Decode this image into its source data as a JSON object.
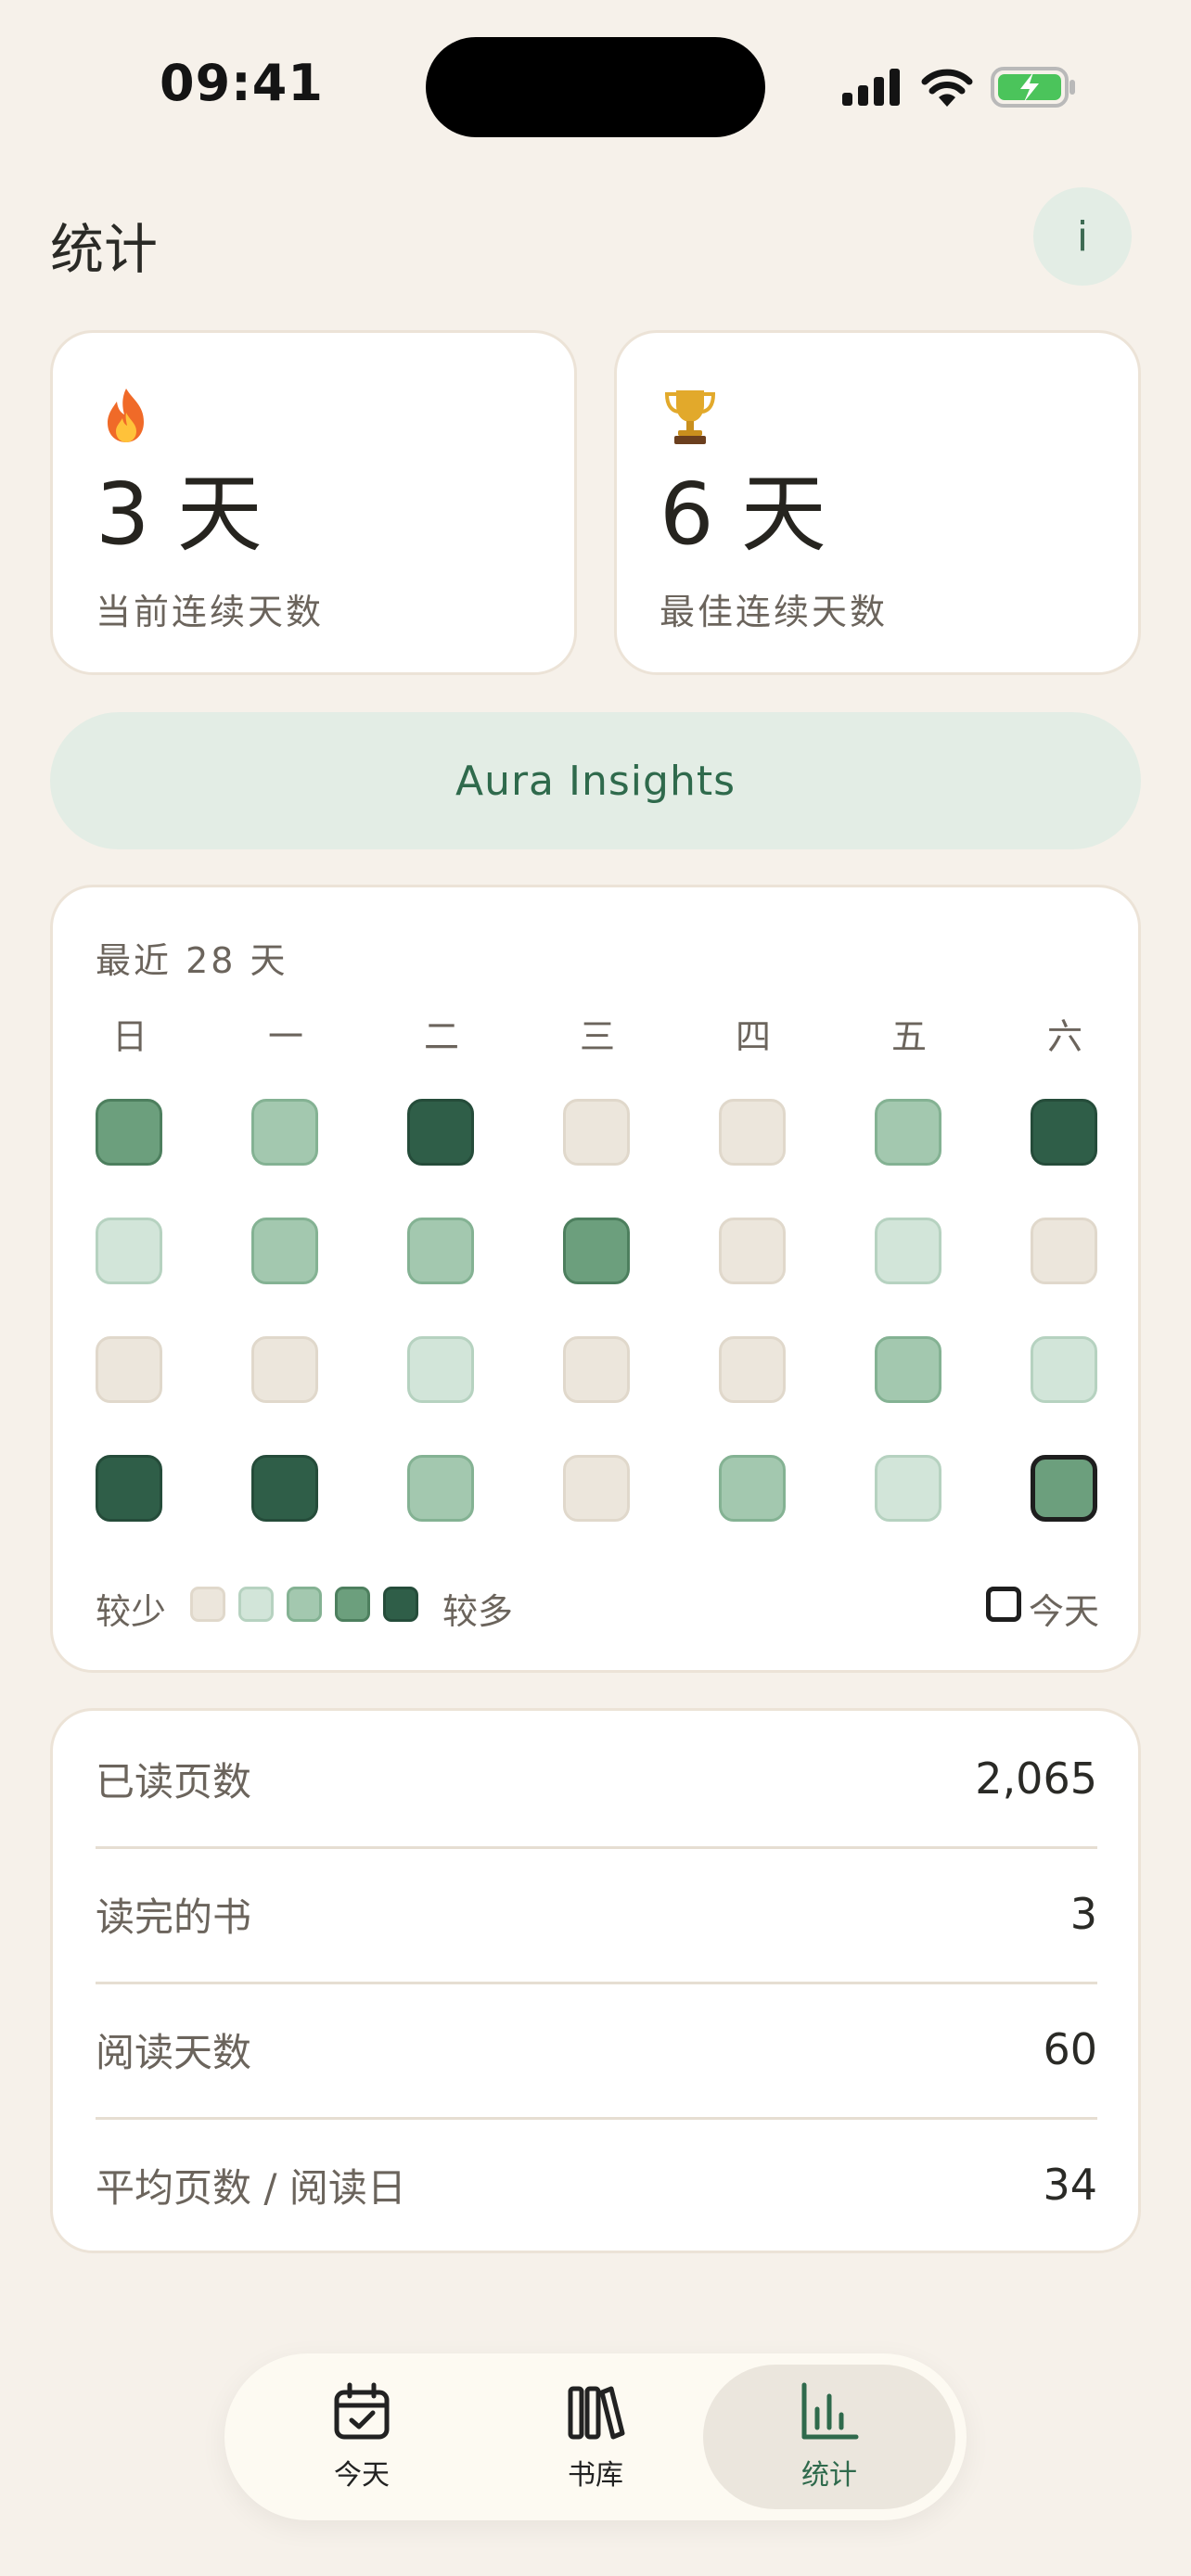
{
  "status_bar": {
    "time": "09:41"
  },
  "header": {
    "title": "统计",
    "info_label": "i"
  },
  "streaks": [
    {
      "icon": "fire-icon",
      "value": "3 天",
      "label": "当前连续天数"
    },
    {
      "icon": "trophy-icon",
      "value": "6 天",
      "label": "最佳连续天数"
    }
  ],
  "insights_button": "Aura Insights",
  "heatmap": {
    "title": "最近 28 天",
    "weekdays": [
      "日",
      "一",
      "二",
      "三",
      "四",
      "五",
      "六"
    ],
    "levels": [
      [
        3,
        2,
        4,
        0,
        0,
        2,
        4
      ],
      [
        1,
        2,
        2,
        3,
        0,
        1,
        0
      ],
      [
        0,
        0,
        1,
        0,
        0,
        2,
        1
      ],
      [
        4,
        4,
        2,
        0,
        2,
        1,
        3
      ]
    ],
    "today_index": 27,
    "legend_less": "较少",
    "legend_more": "较多",
    "legend_today": "今天",
    "level_colors": [
      "#ece6dc",
      "#d2e5d9",
      "#a3c8af",
      "#6c9f7d",
      "#2f5e48"
    ]
  },
  "stats": [
    {
      "label": "已读页数",
      "value": "2,065"
    },
    {
      "label": "读完的书",
      "value": "3"
    },
    {
      "label": "阅读天数",
      "value": "60"
    },
    {
      "label": "平均页数 / 阅读日",
      "value": "34"
    }
  ],
  "tabs": [
    {
      "label": "今天",
      "icon": "calendar-check-icon",
      "active": false
    },
    {
      "label": "书库",
      "icon": "books-icon",
      "active": false
    },
    {
      "label": "统计",
      "icon": "bar-chart-icon",
      "active": true
    }
  ],
  "colors": {
    "accent": "#2f6a4c",
    "background": "#f6f1ea"
  }
}
